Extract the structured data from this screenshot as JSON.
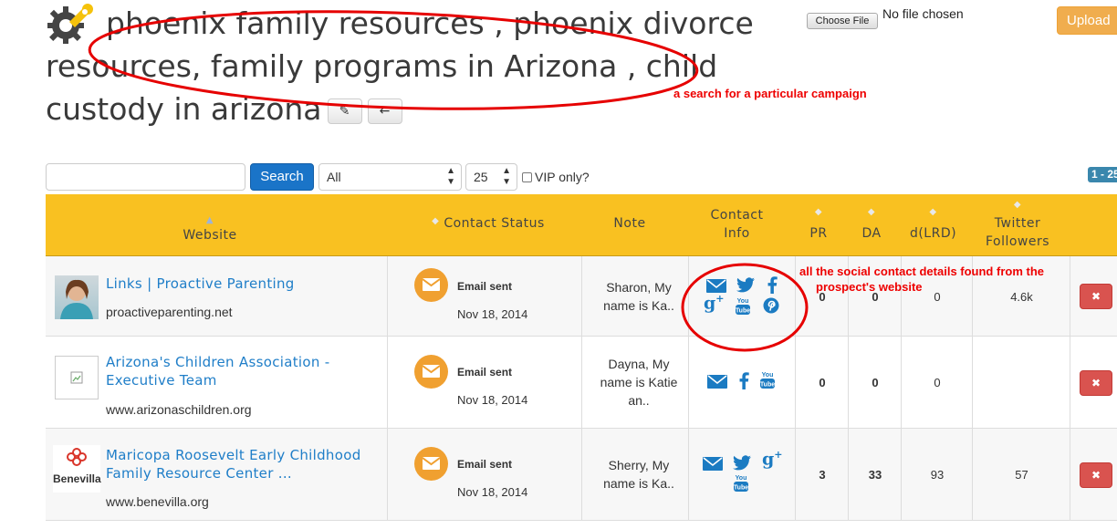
{
  "header": {
    "title": "phoenix family resources , phoenix divorce resources, family programs in Arizona , child custody in arizona",
    "edit_icon": "pencil-icon",
    "back_icon": "arrow-left-icon"
  },
  "upload": {
    "file_button_label": "Choose File",
    "file_status": "No file chosen",
    "upload_label": "Upload"
  },
  "annotations": {
    "campaign": "a search for a particular campaign",
    "social_line1": "all the social contact details found from the",
    "social_line2": "prospect's website"
  },
  "toolbar": {
    "search_value": "",
    "search_label": "Search",
    "filter_selected": "All",
    "page_size_selected": "25",
    "vip_label": "VIP only?",
    "pagination_badge": "1 - 25"
  },
  "table": {
    "columns": {
      "website": "Website",
      "contact_status": "Contact Status",
      "note": "Note",
      "contact_info_1": "Contact",
      "contact_info_2": "Info",
      "pr": "PR",
      "da": "DA",
      "dlrd": "d(LRD)",
      "twitter_1": "Twitter",
      "twitter_2": "Followers"
    },
    "rows": [
      {
        "name": "Links | Proactive Parenting",
        "url": "proactiveparenting.net",
        "status": "Email sent",
        "date": "Nov 18, 2014",
        "note_1": "Sharon,   My",
        "note_2": "name is Ka..",
        "social": [
          "email-icon",
          "twitter-icon",
          "facebook-icon",
          "google-plus-icon",
          "youtube-icon",
          "pinterest-icon"
        ],
        "pr": "0",
        "da": "0",
        "dlrd": "0",
        "twitter_followers": "4.6k"
      },
      {
        "name_1": "Arizona's Children Association -",
        "name_2": "Executive Team",
        "url": "www.arizonaschildren.org",
        "status": "Email sent",
        "date": "Nov 18, 2014",
        "note_1": "Dayna, My",
        "note_2": "name is Katie",
        "note_3": "an..",
        "social": [
          "email-icon",
          "facebook-icon",
          "youtube-icon"
        ],
        "pr": "0",
        "da": "0",
        "dlrd": "0",
        "twitter_followers": ""
      },
      {
        "name_1": "Maricopa Roosevelt Early Childhood",
        "name_2": "Family Resource Center ...",
        "url": "www.benevilla.org",
        "logo_text": "Benevilla",
        "status": "Email sent",
        "date": "Nov 18, 2014",
        "note_1": "Sherry,   My",
        "note_2": "name is Ka..",
        "social": [
          "email-icon",
          "twitter-icon",
          "google-plus-icon",
          "youtube-icon"
        ],
        "pr": "3",
        "da": "33",
        "dlrd": "93",
        "twitter_followers": "57"
      }
    ]
  },
  "colors": {
    "header_bar": "#f9c121",
    "primary_button": "#1a74c8",
    "upload_button": "#f0ad4e",
    "delete_button": "#d9534f",
    "link": "#1f7ec8",
    "social_icon": "#1b7bc2",
    "annotation": "#ee0000"
  }
}
